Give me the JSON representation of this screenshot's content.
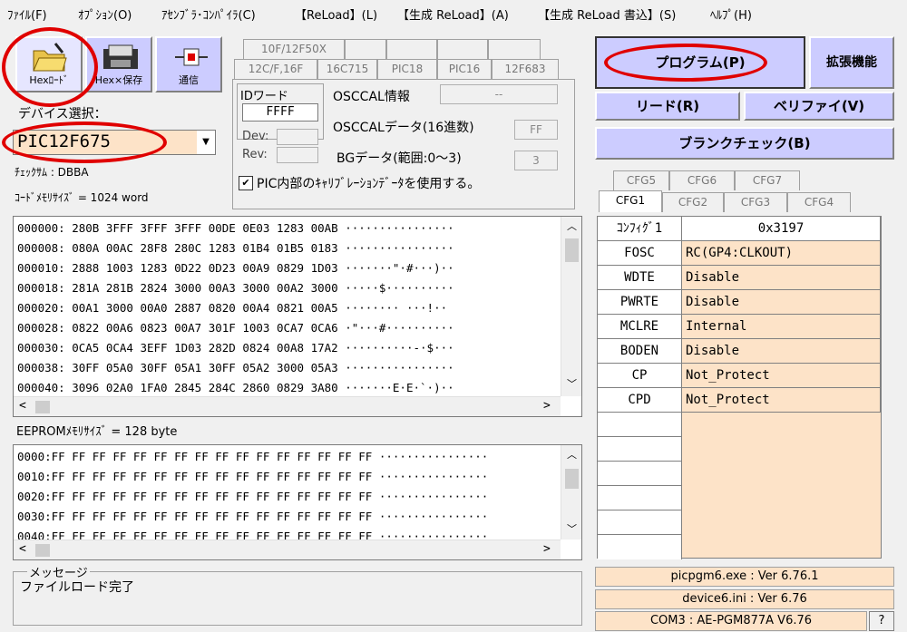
{
  "menu": [
    "ﾌｧｲﾙ(F)",
    "ｵﾌﾟｼｮﾝ(O)",
    "ｱｾﾝﾌﾞﾗ･ｺﾝﾊﾟｲﾗ(C)",
    "【ReLoad】(L)",
    "【生成 ReLoad】(A)",
    "【生成 ReLoad 書込】(S)",
    "ﾍﾙﾌﾟ(H)"
  ],
  "toolbar": {
    "hex_load": "Hexﾛｰﾄﾞ",
    "hex_save": "Hex×保存",
    "comm": "通信"
  },
  "device": {
    "label": "デバイス選択：",
    "selected": "PIC12F675",
    "checksum": "ﾁｪｯｸｻﾑ : DBBA",
    "code_size": "ｺｰﾄﾞﾒﾓﾘｻｲｽﾞ = 1024 word"
  },
  "family_tabs": {
    "back": [
      "10F/12F50X",
      "",
      "",
      "",
      "",
      ""
    ],
    "front": [
      "12C/F,16F",
      "16C715",
      "PIC18",
      "PIC16",
      "12F683"
    ]
  },
  "id_panel": {
    "id_label": "IDワード",
    "id_value": "FFFF",
    "dev_label": "Dev:",
    "rev_label": "Rev:",
    "osccal_info_label": "OSCCAL情報",
    "osccal_info_value": "--",
    "osccal_data_label": "OSCCALデータ(16進数)",
    "osccal_data_value": "FF",
    "bg_label": "BGデータ(範囲:0〜3)",
    "bg_value": "3",
    "calib_label": "PIC内部のｷｬﾘﾌﾞﾚｰｼｮﾝﾃﾞｰﾀを使用する。",
    "calib_checked": "✔"
  },
  "code_lines": [
    "000000: 280B 3FFF 3FFF 3FFF 00DE 0E03 1283 00AB ················",
    "000008: 080A 00AC 28F8 280C 1283 01B4 01B5 0183 ················",
    "000010: 2888 1003 1283 0D22 0D23 00A9 0829 1D03 ·······\"·#···)··",
    "000018: 281A 281B 2824 3000 00A3 3000 00A2 3000 ·····$··········",
    "000020: 00A1 3000 00A0 2887 0820 00A4 0821 00A5 ········ ···!··",
    "000028: 0822 00A6 0823 00A7 301F 1003 0CA7 0CA6 ·\"···#··········",
    "000030: 0CA5 0CA4 3EFF 1D03 282D 0824 00A8 17A2 ··········-·$···",
    "000038: 30FF 05A0 30FF 05A1 30FF 05A2 3000 05A3 ················",
    "000040: 3096 02A0 1FA0 2845 284C 2860 0829 3A80 ·······E·E·`·)··"
  ],
  "eeprom": {
    "label": "EEPROMﾒﾓﾘｻｲｽﾞ = 128 byte",
    "lines": [
      "0000:FF FF FF FF FF FF FF FF FF FF FF FF FF FF FF FF ················",
      "0010:FF FF FF FF FF FF FF FF FF FF FF FF FF FF FF FF ················",
      "0020:FF FF FF FF FF FF FF FF FF FF FF FF FF FF FF FF ················",
      "0030:FF FF FF FF FF FF FF FF FF FF FF FF FF FF FF FF ················",
      "0040:FF FF FF FF FF FF FF FF FF FF FF FF FF FF FF FF ················"
    ]
  },
  "message": {
    "label": "メッセージ",
    "text": "ファイルロード完了"
  },
  "buttons": {
    "program": "プログラム(P)",
    "extend": "拡張機能",
    "read": "リード(R)",
    "verify": "ベリファイ(V)",
    "blank": "ブランクチェック(B)"
  },
  "cfg_tabs": {
    "back": [
      "CFG5",
      "CFG6",
      "CFG7"
    ],
    "front": [
      "CFG1",
      "CFG2",
      "CFG3",
      "CFG4"
    ]
  },
  "config": {
    "header_name": "ｺﾝﾌｨｸﾞ1",
    "header_value": "0x3197",
    "rows": [
      {
        "name": "FOSC",
        "value": "RC(GP4:CLKOUT)"
      },
      {
        "name": "WDTE",
        "value": "Disable"
      },
      {
        "name": "PWRTE",
        "value": "Disable"
      },
      {
        "name": "MCLRE",
        "value": "Internal"
      },
      {
        "name": "BODEN",
        "value": "Disable"
      },
      {
        "name": "CP",
        "value": "Not_Protect"
      },
      {
        "name": "CPD",
        "value": "Not_Protect"
      }
    ]
  },
  "status": {
    "exe": "picpgm6.exe : Ver 6.76.1",
    "ini": "device6.ini : Ver 6.76",
    "com": "COM3 : AE-PGM877A V6.76",
    "help": "?"
  },
  "colors": {
    "button_bg": "#ccccff",
    "value_bg": "#fde3c8",
    "highlight": "#e00000"
  }
}
